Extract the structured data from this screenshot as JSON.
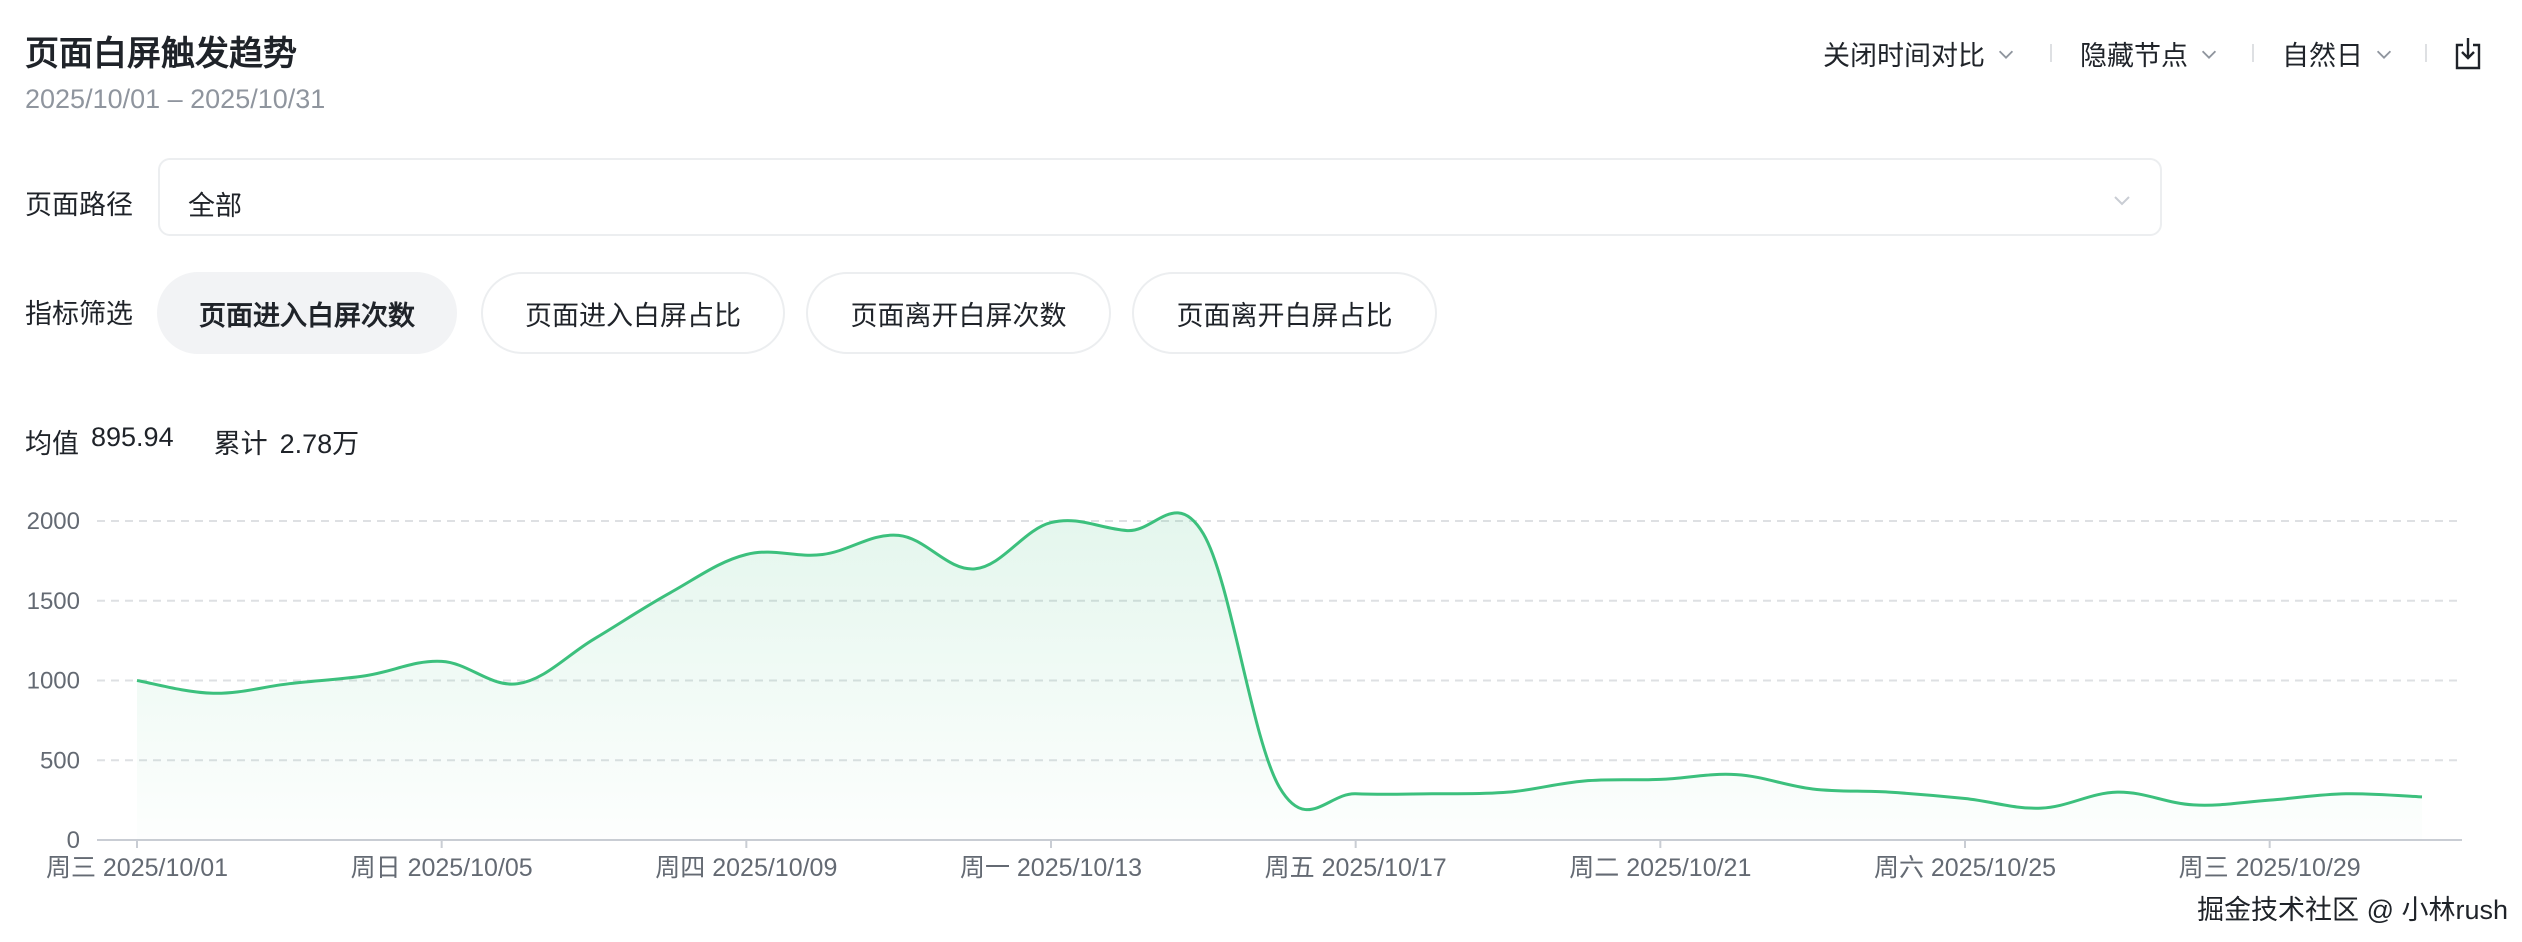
{
  "title": "页面白屏触发趋势",
  "date_range": "2025/10/01 – 2025/10/31",
  "toolbar": {
    "compare_label": "关闭时间对比",
    "nodes_label": "隐藏节点",
    "granularity_label": "自然日",
    "export_icon": "export-icon"
  },
  "filters": {
    "path_label": "页面路径",
    "path_value": "全部",
    "metric_label": "指标筛选",
    "metrics": [
      "页面进入白屏次数",
      "页面进入白屏占比",
      "页面离开白屏次数",
      "页面离开白屏占比"
    ],
    "active_metric": "页面进入白屏次数"
  },
  "stats": {
    "avg_label": "均值",
    "avg_value": "895.94",
    "total_label": "累计",
    "total_value": "2.78万"
  },
  "colors": {
    "line": "#3cc07d",
    "grid": "#dee0e3",
    "axis": "#c9cdd4"
  },
  "watermark": "掘金技术社区 @ 小林rush",
  "chart_data": {
    "type": "area",
    "x": [
      "2025/10/01",
      "2025/10/02",
      "2025/10/03",
      "2025/10/04",
      "2025/10/05",
      "2025/10/06",
      "2025/10/07",
      "2025/10/08",
      "2025/10/09",
      "2025/10/10",
      "2025/10/11",
      "2025/10/12",
      "2025/10/13",
      "2025/10/14",
      "2025/10/15",
      "2025/10/16",
      "2025/10/17",
      "2025/10/18",
      "2025/10/19",
      "2025/10/20",
      "2025/10/21",
      "2025/10/22",
      "2025/10/23",
      "2025/10/24",
      "2025/10/25",
      "2025/10/26",
      "2025/10/27",
      "2025/10/28",
      "2025/10/29",
      "2025/10/30",
      "2025/10/31"
    ],
    "values": [
      1000,
      920,
      980,
      1030,
      1120,
      980,
      1260,
      1550,
      1790,
      1790,
      1910,
      1700,
      1990,
      1940,
      1920,
      330,
      290,
      290,
      300,
      370,
      380,
      410,
      320,
      300,
      260,
      200,
      300,
      220,
      250,
      290,
      270
    ],
    "yticks": [
      0,
      500,
      1000,
      1500,
      2000
    ],
    "ylim": [
      0,
      2000
    ],
    "xticks": [
      {
        "index": 0,
        "label": "周三 2025/10/01"
      },
      {
        "index": 4,
        "label": "周日 2025/10/05"
      },
      {
        "index": 8,
        "label": "周四 2025/10/09"
      },
      {
        "index": 12,
        "label": "周一 2025/10/13"
      },
      {
        "index": 16,
        "label": "周五 2025/10/17"
      },
      {
        "index": 20,
        "label": "周二 2025/10/21"
      },
      {
        "index": 24,
        "label": "周六 2025/10/25"
      },
      {
        "index": 28,
        "label": "周三 2025/10/29"
      }
    ],
    "grid": true,
    "legend": "none"
  }
}
